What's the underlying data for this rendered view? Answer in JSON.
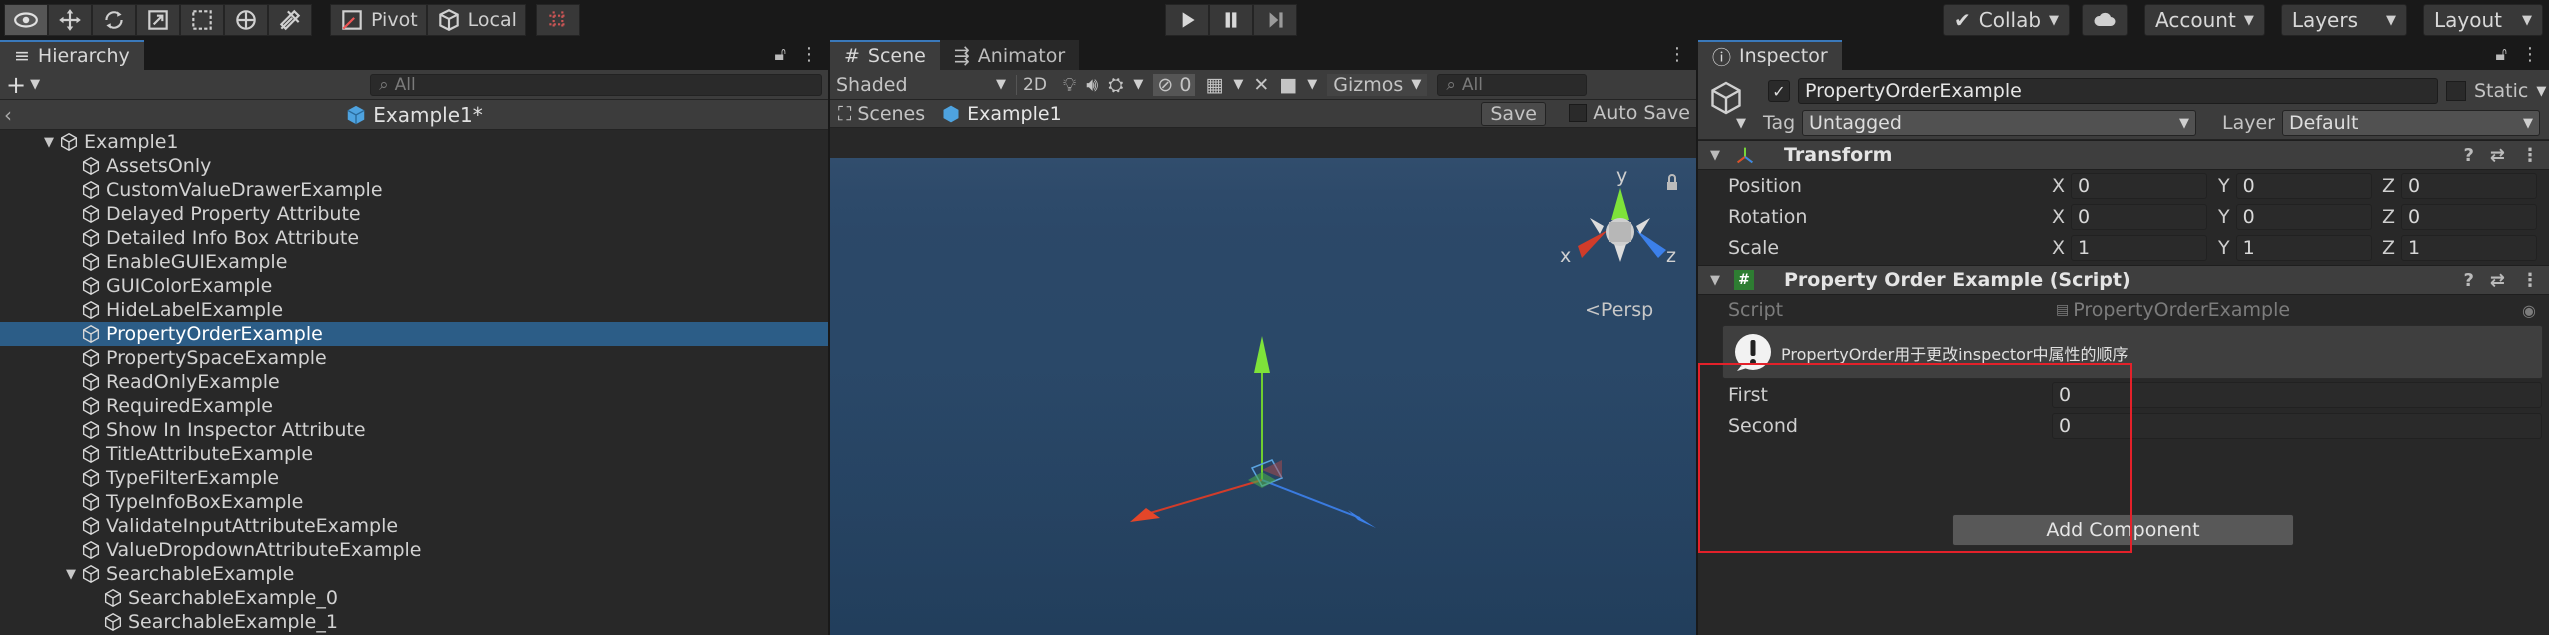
{
  "toolbar": {
    "pivot": "Pivot",
    "local": "Local",
    "collab": "Collab",
    "account": "Account",
    "layers": "Layers",
    "layout": "Layout"
  },
  "hierarchy": {
    "tab": "Hierarchy",
    "search_placeholder": "All",
    "scene": "Example1*",
    "items": [
      {
        "label": "Example1",
        "depth": 0,
        "expand": "▼",
        "selected": false
      },
      {
        "label": "AssetsOnly",
        "depth": 1,
        "expand": "",
        "selected": false
      },
      {
        "label": "CustomValueDrawerExample",
        "depth": 1,
        "expand": "",
        "selected": false
      },
      {
        "label": "Delayed Property Attribute",
        "depth": 1,
        "expand": "",
        "selected": false
      },
      {
        "label": "Detailed Info Box Attribute",
        "depth": 1,
        "expand": "",
        "selected": false
      },
      {
        "label": "EnableGUIExample",
        "depth": 1,
        "expand": "",
        "selected": false
      },
      {
        "label": "GUIColorExample",
        "depth": 1,
        "expand": "",
        "selected": false
      },
      {
        "label": "HideLabelExample",
        "depth": 1,
        "expand": "",
        "selected": false
      },
      {
        "label": "PropertyOrderExample",
        "depth": 1,
        "expand": "",
        "selected": true
      },
      {
        "label": "PropertySpaceExample",
        "depth": 1,
        "expand": "",
        "selected": false
      },
      {
        "label": "ReadOnlyExample",
        "depth": 1,
        "expand": "",
        "selected": false
      },
      {
        "label": "RequiredExample",
        "depth": 1,
        "expand": "",
        "selected": false
      },
      {
        "label": "Show In Inspector Attribute",
        "depth": 1,
        "expand": "",
        "selected": false
      },
      {
        "label": "TitleAttributeExample",
        "depth": 1,
        "expand": "",
        "selected": false
      },
      {
        "label": "TypeFilterExample",
        "depth": 1,
        "expand": "",
        "selected": false
      },
      {
        "label": "TypeInfoBoxExample",
        "depth": 1,
        "expand": "",
        "selected": false
      },
      {
        "label": "ValidateInputAttributeExample",
        "depth": 1,
        "expand": "",
        "selected": false
      },
      {
        "label": "ValueDropdownAttributeExample",
        "depth": 1,
        "expand": "",
        "selected": false
      },
      {
        "label": "SearchableExample",
        "depth": 1,
        "expand": "▼",
        "selected": false
      },
      {
        "label": "SearchableExample_0",
        "depth": 2,
        "expand": "",
        "selected": false
      },
      {
        "label": "SearchableExample_1",
        "depth": 2,
        "expand": "",
        "selected": false
      }
    ]
  },
  "scene": {
    "tab_scene": "Scene",
    "tab_animator": "Animator",
    "shading": "Shaded",
    "mode_2d": "2D",
    "hidden_count": "0",
    "gizmos": "Gizmos",
    "search_placeholder": "All",
    "breadcrumb_root": "Scenes",
    "breadcrumb_scene": "Example1",
    "save": "Save",
    "auto_save": "Auto Save",
    "persp": "<Persp",
    "axis_y": "y",
    "axis_x": "x",
    "axis_z": "z"
  },
  "inspector": {
    "tab": "Inspector",
    "object_name": "PropertyOrderExample",
    "static_label": "Static",
    "tag_label": "Tag",
    "tag_value": "Untagged",
    "layer_label": "Layer",
    "layer_value": "Default",
    "transform": {
      "title": "Transform",
      "rows": [
        {
          "label": "Position",
          "x": "0",
          "y": "0",
          "z": "0"
        },
        {
          "label": "Rotation",
          "x": "0",
          "y": "0",
          "z": "0"
        },
        {
          "label": "Scale",
          "x": "1",
          "y": "1",
          "z": "1"
        }
      ],
      "axis_x": "X",
      "axis_y": "Y",
      "axis_z": "Z"
    },
    "script_component": {
      "title": "Property Order Example (Script)",
      "script_label": "Script",
      "script_value": "PropertyOrderExample",
      "info": "PropertyOrder用于更改inspector中属性的顺序",
      "fields": [
        {
          "label": "First",
          "value": "0"
        },
        {
          "label": "Second",
          "value": "0"
        }
      ]
    },
    "add_component": "Add Component"
  },
  "colors": {
    "accent": "#3a79bb",
    "selection": "#2c5d87",
    "highlight_box": "#e4212a"
  }
}
